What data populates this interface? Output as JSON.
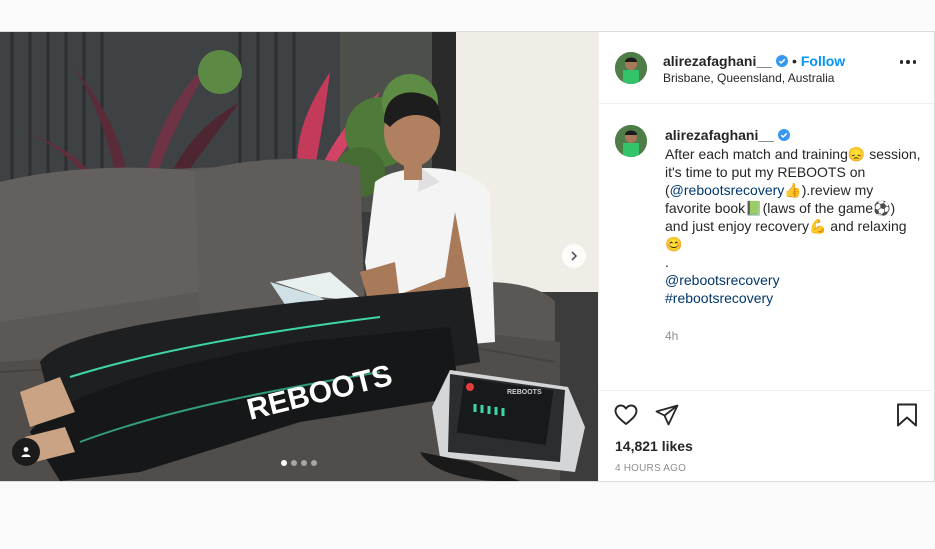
{
  "post": {
    "username": "alirezafaghani__",
    "verified": true,
    "follow_label": "Follow",
    "bullet": "•",
    "location": "Brisbane, Queensland, Australia",
    "caption": {
      "text_before_mention": "After each match and training😞 session, it's time to put my REBOOTS on (",
      "mention": "@rebootsrecovery",
      "text_after_mention": "👍).review my favorite book📗(laws of the game⚽) and just enjoy recovery💪 and relaxing😊",
      "dot_line": ".",
      "mention_2": "@rebootsrecovery",
      "hashtag": "#rebootsrecovery",
      "relative_time": "4h"
    },
    "likes": "14,821 likes",
    "timestamp": "4 HOURS AGO",
    "carousel": {
      "count": 4,
      "active_index": 0
    }
  },
  "photo": {
    "brand_text": "REBOOTS",
    "device_label": "REBOOTS"
  },
  "colors": {
    "accent": "#0095f6",
    "verified_blue": "#3897f0",
    "text_primary": "#262626",
    "text_secondary": "#8e8e8e",
    "link": "#00376b"
  },
  "icons": [
    "verified-badge-icon",
    "more-options-icon",
    "heart-icon",
    "share-icon",
    "bookmark-icon",
    "chevron-right-icon",
    "user-tag-icon"
  ]
}
